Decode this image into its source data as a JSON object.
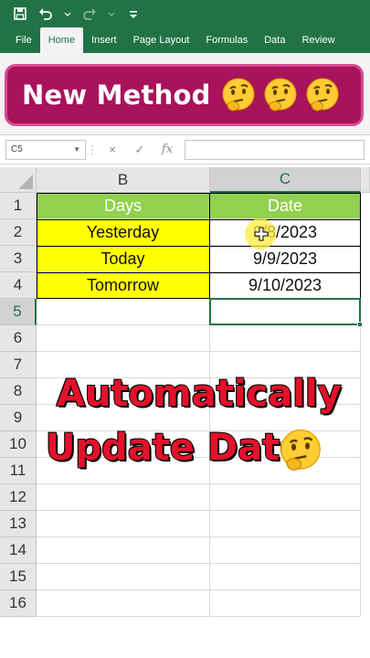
{
  "titlebar": {
    "icons": [
      "save-icon",
      "undo-icon",
      "redo-icon",
      "customize-icon"
    ]
  },
  "ribbon": {
    "tabs": [
      "File",
      "Home",
      "Insert",
      "Page Layout",
      "Formulas",
      "Data",
      "Review"
    ],
    "active_tab": "Home"
  },
  "banner": {
    "text": "New Method",
    "emoji": "thinking-face",
    "emoji_count": 3
  },
  "formula_bar": {
    "name_box": "C5",
    "cancel": "×",
    "enter": "✓",
    "fx": "fx",
    "value": ""
  },
  "grid": {
    "columns": [
      "B",
      "C"
    ],
    "selected_column": "C",
    "rows": [
      "1",
      "2",
      "3",
      "4",
      "5",
      "6",
      "7",
      "8",
      "9",
      "10",
      "11",
      "12",
      "13",
      "14",
      "15",
      "16"
    ],
    "selected_row": "5",
    "header": {
      "days": "Days",
      "date": "Date"
    },
    "data": [
      {
        "day": "Yesterday",
        "date": "9/8/2023"
      },
      {
        "day": "Today",
        "date": "9/9/2023"
      },
      {
        "day": "Tomorrow",
        "date": "9/10/2023"
      }
    ]
  },
  "overlay": {
    "line1": "Automatically",
    "line2": "Update Date"
  },
  "colors": {
    "excel_green": "#217346",
    "banner_bg": "#a8135c",
    "header_fill": "#92d050",
    "day_fill": "#ffff00",
    "overlay_text": "#e3112b"
  }
}
